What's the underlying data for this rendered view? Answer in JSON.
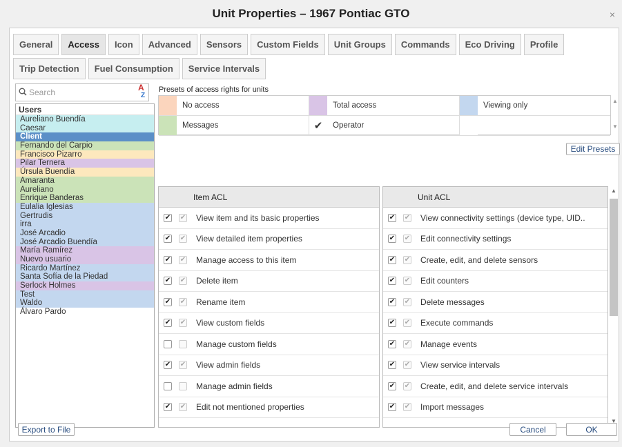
{
  "window": {
    "title": "Unit Properties – 1967 Pontiac GTO",
    "close": "×"
  },
  "tabs_row1": [
    {
      "label": "General",
      "active": false
    },
    {
      "label": "Access",
      "active": true
    },
    {
      "label": "Icon",
      "active": false
    },
    {
      "label": "Advanced",
      "active": false
    },
    {
      "label": "Sensors",
      "active": false
    },
    {
      "label": "Custom Fields",
      "active": false
    },
    {
      "label": "Unit Groups",
      "active": false
    },
    {
      "label": "Commands",
      "active": false
    },
    {
      "label": "Eco Driving",
      "active": false
    },
    {
      "label": "Profile",
      "active": false
    }
  ],
  "tabs_row2": [
    {
      "label": "Trip Detection"
    },
    {
      "label": "Fuel Consumption"
    },
    {
      "label": "Service Intervals"
    }
  ],
  "search": {
    "placeholder": "Search",
    "sort_icon": "A→Z sort"
  },
  "users": {
    "header": "Users",
    "items": [
      {
        "name": "Aureliano Buendía",
        "color": "#c6eef0"
      },
      {
        "name": "Caesar",
        "color": "#c6eef0"
      },
      {
        "name": "Client",
        "color": "#5b8fc7",
        "selected": true
      },
      {
        "name": "Fernando del Carpio",
        "color": "#cbe3b8"
      },
      {
        "name": "Francisco Pizarro",
        "color": "#fde8bd"
      },
      {
        "name": "Pilar Ternera",
        "color": "#d9c4e6"
      },
      {
        "name": "Úrsula Buendía",
        "color": "#fde8bd"
      },
      {
        "name": "Amaranta",
        "color": "#cbe3b8"
      },
      {
        "name": "Aureliano",
        "color": "#cbe3b8"
      },
      {
        "name": "Enrique Banderas",
        "color": "#cbe3b8"
      },
      {
        "name": "Eulalia Iglesias",
        "color": "#c3d7ef"
      },
      {
        "name": "Gertrudis",
        "color": "#c3d7ef"
      },
      {
        "name": "irra",
        "color": "#c3d7ef"
      },
      {
        "name": "José Arcadio",
        "color": "#c3d7ef"
      },
      {
        "name": "José Arcadio Buendía",
        "color": "#c3d7ef"
      },
      {
        "name": "María Ramírez",
        "color": "#d9c4e6"
      },
      {
        "name": "Nuevo usuario",
        "color": "#d9c4e6"
      },
      {
        "name": "Ricardo Martínez",
        "color": "#c3d7ef"
      },
      {
        "name": "Santa Sofía de la Piedad",
        "color": "#c3d7ef"
      },
      {
        "name": "Serlock Holmes",
        "color": "#d9c4e6"
      },
      {
        "name": "Test",
        "color": "#c3d7ef"
      },
      {
        "name": "Waldo",
        "color": "#c3d7ef"
      },
      {
        "name": "Álvaro Pardo",
        "color": "#ffffff"
      }
    ]
  },
  "presets": {
    "title": "Presets of access rights for units",
    "items": [
      {
        "label": "No access",
        "color": "#fbd5bd"
      },
      {
        "label": "Total access",
        "color": "#d9c4e6"
      },
      {
        "label": "Viewing  only",
        "color": "#c3d7ef"
      },
      {
        "label": "Messages",
        "color": "#cbe3b8"
      },
      {
        "label": "Operator",
        "color": "#c6eef0",
        "checked_mark": "✔"
      },
      {
        "label": "",
        "color": "#ffffff"
      }
    ],
    "edit_button": "Edit Presets"
  },
  "item_acl": {
    "header": "Item ACL",
    "rows": [
      {
        "label": "View item and its basic properties",
        "checked": true
      },
      {
        "label": "View detailed item properties",
        "checked": true
      },
      {
        "label": "Manage access to this item",
        "checked": true
      },
      {
        "label": "Delete item",
        "checked": true
      },
      {
        "label": "Rename item",
        "checked": true
      },
      {
        "label": "View custom fields",
        "checked": true
      },
      {
        "label": "Manage custom fields",
        "checked": false
      },
      {
        "label": "View admin fields",
        "checked": true
      },
      {
        "label": "Manage admin fields",
        "checked": false
      },
      {
        "label": "Edit not mentioned properties",
        "checked": true
      }
    ]
  },
  "unit_acl": {
    "header": "Unit ACL",
    "rows": [
      {
        "label": "View connectivity settings (device type, UID..",
        "checked": true
      },
      {
        "label": "Edit connectivity settings",
        "checked": true
      },
      {
        "label": "Create, edit, and delete sensors",
        "checked": true
      },
      {
        "label": "Edit counters",
        "checked": true
      },
      {
        "label": "Delete messages",
        "checked": true
      },
      {
        "label": "Execute commands",
        "checked": true
      },
      {
        "label": "Manage events",
        "checked": true
      },
      {
        "label": "View service intervals",
        "checked": true
      },
      {
        "label": "Create, edit, and delete service intervals",
        "checked": true
      },
      {
        "label": "Import messages",
        "checked": true
      }
    ]
  },
  "footer": {
    "export": "Export to File",
    "cancel": "Cancel",
    "ok": "OK"
  },
  "icons": {
    "check": "✔",
    "search": "search-icon",
    "scroll_up": "▲",
    "scroll_down": "▼"
  }
}
